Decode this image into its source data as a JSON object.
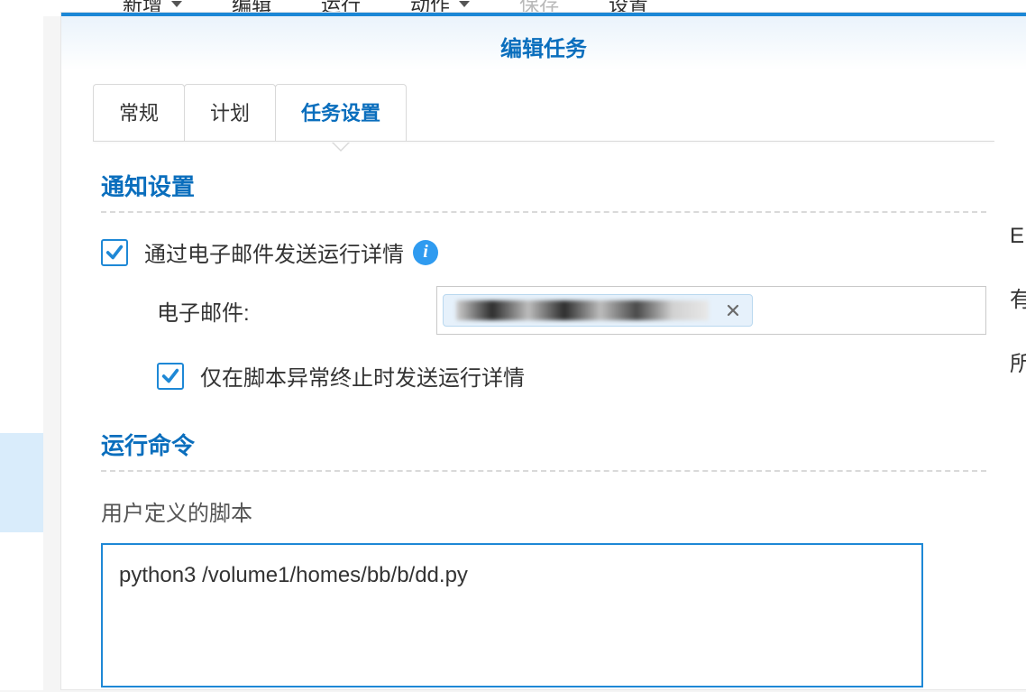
{
  "bgToolbar": {
    "new": "新增",
    "edit": "编辑",
    "run": "运行",
    "action": "动作",
    "save": "保存",
    "settings": "设置"
  },
  "modal": {
    "title": "编辑任务",
    "tabs": {
      "general": "常规",
      "schedule": "计划",
      "taskSettings": "任务设置"
    }
  },
  "sections": {
    "notification": {
      "title": "通知设置",
      "sendEmail": "通过电子邮件发送运行详情",
      "emailLabel": "电子邮件:",
      "onlyOnError": "仅在脚本异常终止时发送运行详情"
    },
    "runCommand": {
      "title": "运行命令",
      "userScriptLabel": "用户定义的脚本",
      "scriptValue": "python3 /volume1/homes/bb/b/dd.py"
    }
  },
  "rightEdgeHints": [
    "E",
    "有",
    "所"
  ]
}
